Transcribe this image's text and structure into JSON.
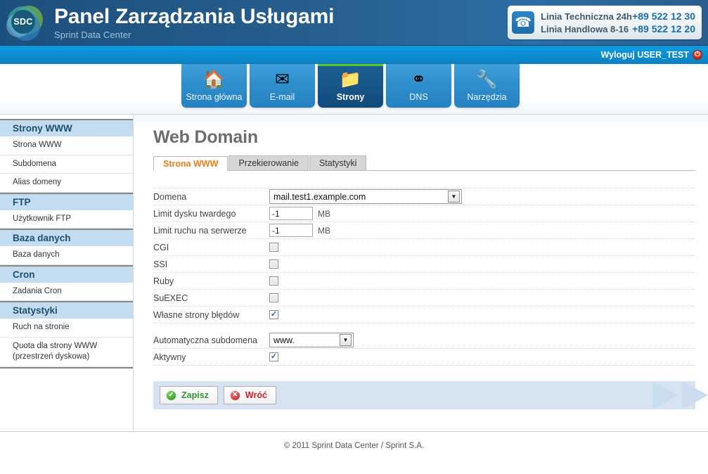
{
  "header": {
    "logo_text": "SDC",
    "title": "Panel Zarządzania Usługami",
    "subtitle": "Sprint Data Center",
    "contact": {
      "phone_icon": "phone-icon",
      "lines": [
        {
          "label": "Linia Techniczna 24h",
          "number": "+89 522 12 30"
        },
        {
          "label": "Linia Handlowa 8-16",
          "number": "+89 522 12 20"
        }
      ]
    }
  },
  "topbar": {
    "logout_label": "Wyloguj USER_TEST",
    "logout_icon": "power-icon"
  },
  "nav": {
    "tabs": [
      {
        "label": "Strona główna",
        "icon": "house-icon",
        "glyph": "🏠",
        "active": false
      },
      {
        "label": "E-mail",
        "icon": "envelope-icon",
        "glyph": "✉",
        "active": false
      },
      {
        "label": "Strony",
        "icon": "folder-web-icon",
        "glyph": "📁",
        "active": true
      },
      {
        "label": "DNS",
        "icon": "network-nodes-icon",
        "glyph": "⁂",
        "active": false
      },
      {
        "label": "Narzędzia",
        "icon": "tools-icon",
        "glyph": "🔧",
        "active": false
      }
    ]
  },
  "sidebar": {
    "groups": [
      {
        "heading": "Strony WWW",
        "items": [
          "Strona WWW",
          "Subdomena",
          "Alias domeny"
        ]
      },
      {
        "heading": "FTP",
        "items": [
          "Użytkownik FTP"
        ]
      },
      {
        "heading": "Baza danych",
        "items": [
          "Baza danych"
        ]
      },
      {
        "heading": "Cron",
        "items": [
          "Zadania Cron"
        ]
      },
      {
        "heading": "Statystyki",
        "items": [
          "Ruch na stronie",
          "Quota dla strony WWW (przestrzeń dyskowa)"
        ]
      }
    ]
  },
  "main": {
    "page_title": "Web Domain",
    "tabs": [
      {
        "label": "Strona WWW",
        "active": true
      },
      {
        "label": "Przekierowanie",
        "active": false
      },
      {
        "label": "Statystyki",
        "active": false
      }
    ],
    "fields": {
      "domain_label": "Domena",
      "domain_value": "mail.test1.example.com",
      "disk_limit_label": "Limit dysku twardego",
      "disk_limit_value": "-1",
      "disk_limit_unit": "MB",
      "traffic_limit_label": "Limit ruchu na serwerze",
      "traffic_limit_value": "-1",
      "traffic_limit_unit": "MB",
      "cgi_label": "CGI",
      "cgi_checked": false,
      "ssi_label": "SSI",
      "ssi_checked": false,
      "ruby_label": "Ruby",
      "ruby_checked": false,
      "suexec_label": "SuEXEC",
      "suexec_checked": false,
      "error_pages_label": "Własne strony błędów",
      "error_pages_checked": true,
      "auto_subdomain_label": "Automatyczna subdomena",
      "auto_subdomain_value": "www.",
      "active_label": "Aktywny",
      "active_checked": true
    },
    "buttons": {
      "save_label": "Zapisz",
      "save_icon": "check-circle-icon",
      "back_label": "Wróć",
      "back_icon": "cancel-circle-icon"
    }
  },
  "footer": {
    "text": "© 2011 Sprint Data Center / Sprint S.A."
  },
  "colors": {
    "header_blue": "#275f8f",
    "bar_blue": "#0b8ed3",
    "tab_blue": "#2f8fcd",
    "active_tab_blue": "#17558a",
    "active_accent_green": "#55c42b",
    "sidebar_head_blue": "#c3dcf0",
    "active_tab_orange": "#ef7d1a",
    "action_bar_blue": "#d6e4f2",
    "chevron_blue": "#cadcee"
  }
}
